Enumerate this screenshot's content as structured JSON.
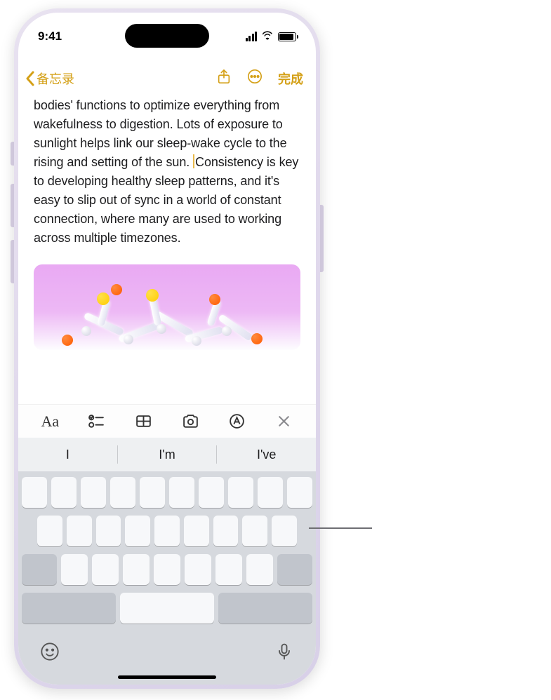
{
  "status": {
    "time": "9:41"
  },
  "nav": {
    "back_label": "备忘录",
    "done_label": "完成"
  },
  "note": {
    "body_pre": "bodies' functions to optimize everything from wakefulness to digestion. Lots of exposure to sunlight helps link our sleep-wake cycle to the rising and setting of the sun. ",
    "body_post": "Consistency is key to developing healthy sleep patterns, and it's easy to slip out of sync in a world of constant connection, where many are used to working across multiple timezones."
  },
  "suggestions": {
    "a": "I",
    "b": "I'm",
    "c": "I've"
  }
}
